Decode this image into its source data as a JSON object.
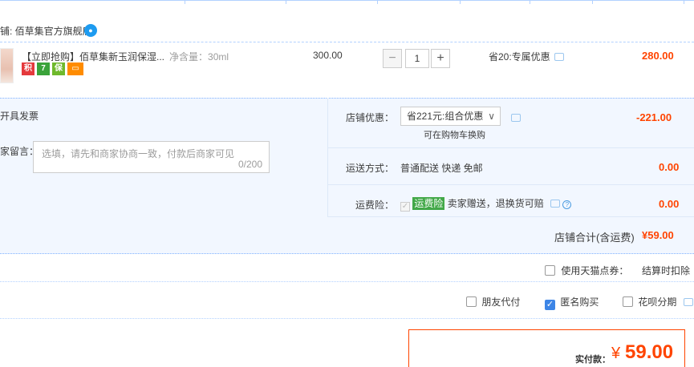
{
  "shop": {
    "name": "铺: 佰草集官方旗舰店",
    "chat_icon_glyph": "●"
  },
  "item": {
    "title": "【立即抢购】佰草集新玉润保湿...",
    "spec": "净含量：30ml",
    "badges": [
      "积",
      "7",
      "保",
      "▭"
    ],
    "unit_price": "300.00",
    "quantity": "1",
    "minus": "−",
    "plus": "+",
    "promo": "省20:专属优惠",
    "total": "280.00"
  },
  "invoice": {
    "label": "开具发票"
  },
  "message": {
    "label": "家留言：",
    "placeholder": "选填，请先和商家协商一致，付款后商家可见",
    "count": "0/200"
  },
  "coupon": {
    "label": "店铺优惠：",
    "selected": "省221元:组合优惠",
    "chevron": "∨",
    "note": "可在购物车换购",
    "value": "-221.00"
  },
  "shipping": {
    "label": "运送方式：",
    "method": "普通配送 快递 免邮",
    "value": "0.00"
  },
  "insurance": {
    "label": "运费险：",
    "tag": "运费险",
    "desc": "卖家赠送，退换货可赔",
    "help": "?",
    "value": "0.00"
  },
  "shop_total": {
    "label": "店铺合计(含运费)",
    "value": "¥59.00"
  },
  "tmall_points": {
    "label": "使用天猫点券：",
    "note": "结算时扣除"
  },
  "options": [
    {
      "label": "朋友代付",
      "checked": false
    },
    {
      "label": "匿名购买",
      "checked": true
    },
    {
      "label": "花呗分期",
      "checked": false
    }
  ],
  "payment": {
    "label": "实付款：",
    "currency": "¥",
    "amount": "59.00"
  },
  "colors": {
    "accent": "#ff4400",
    "border_blue": "#b2d1ff",
    "panel": "#f2f7ff"
  }
}
